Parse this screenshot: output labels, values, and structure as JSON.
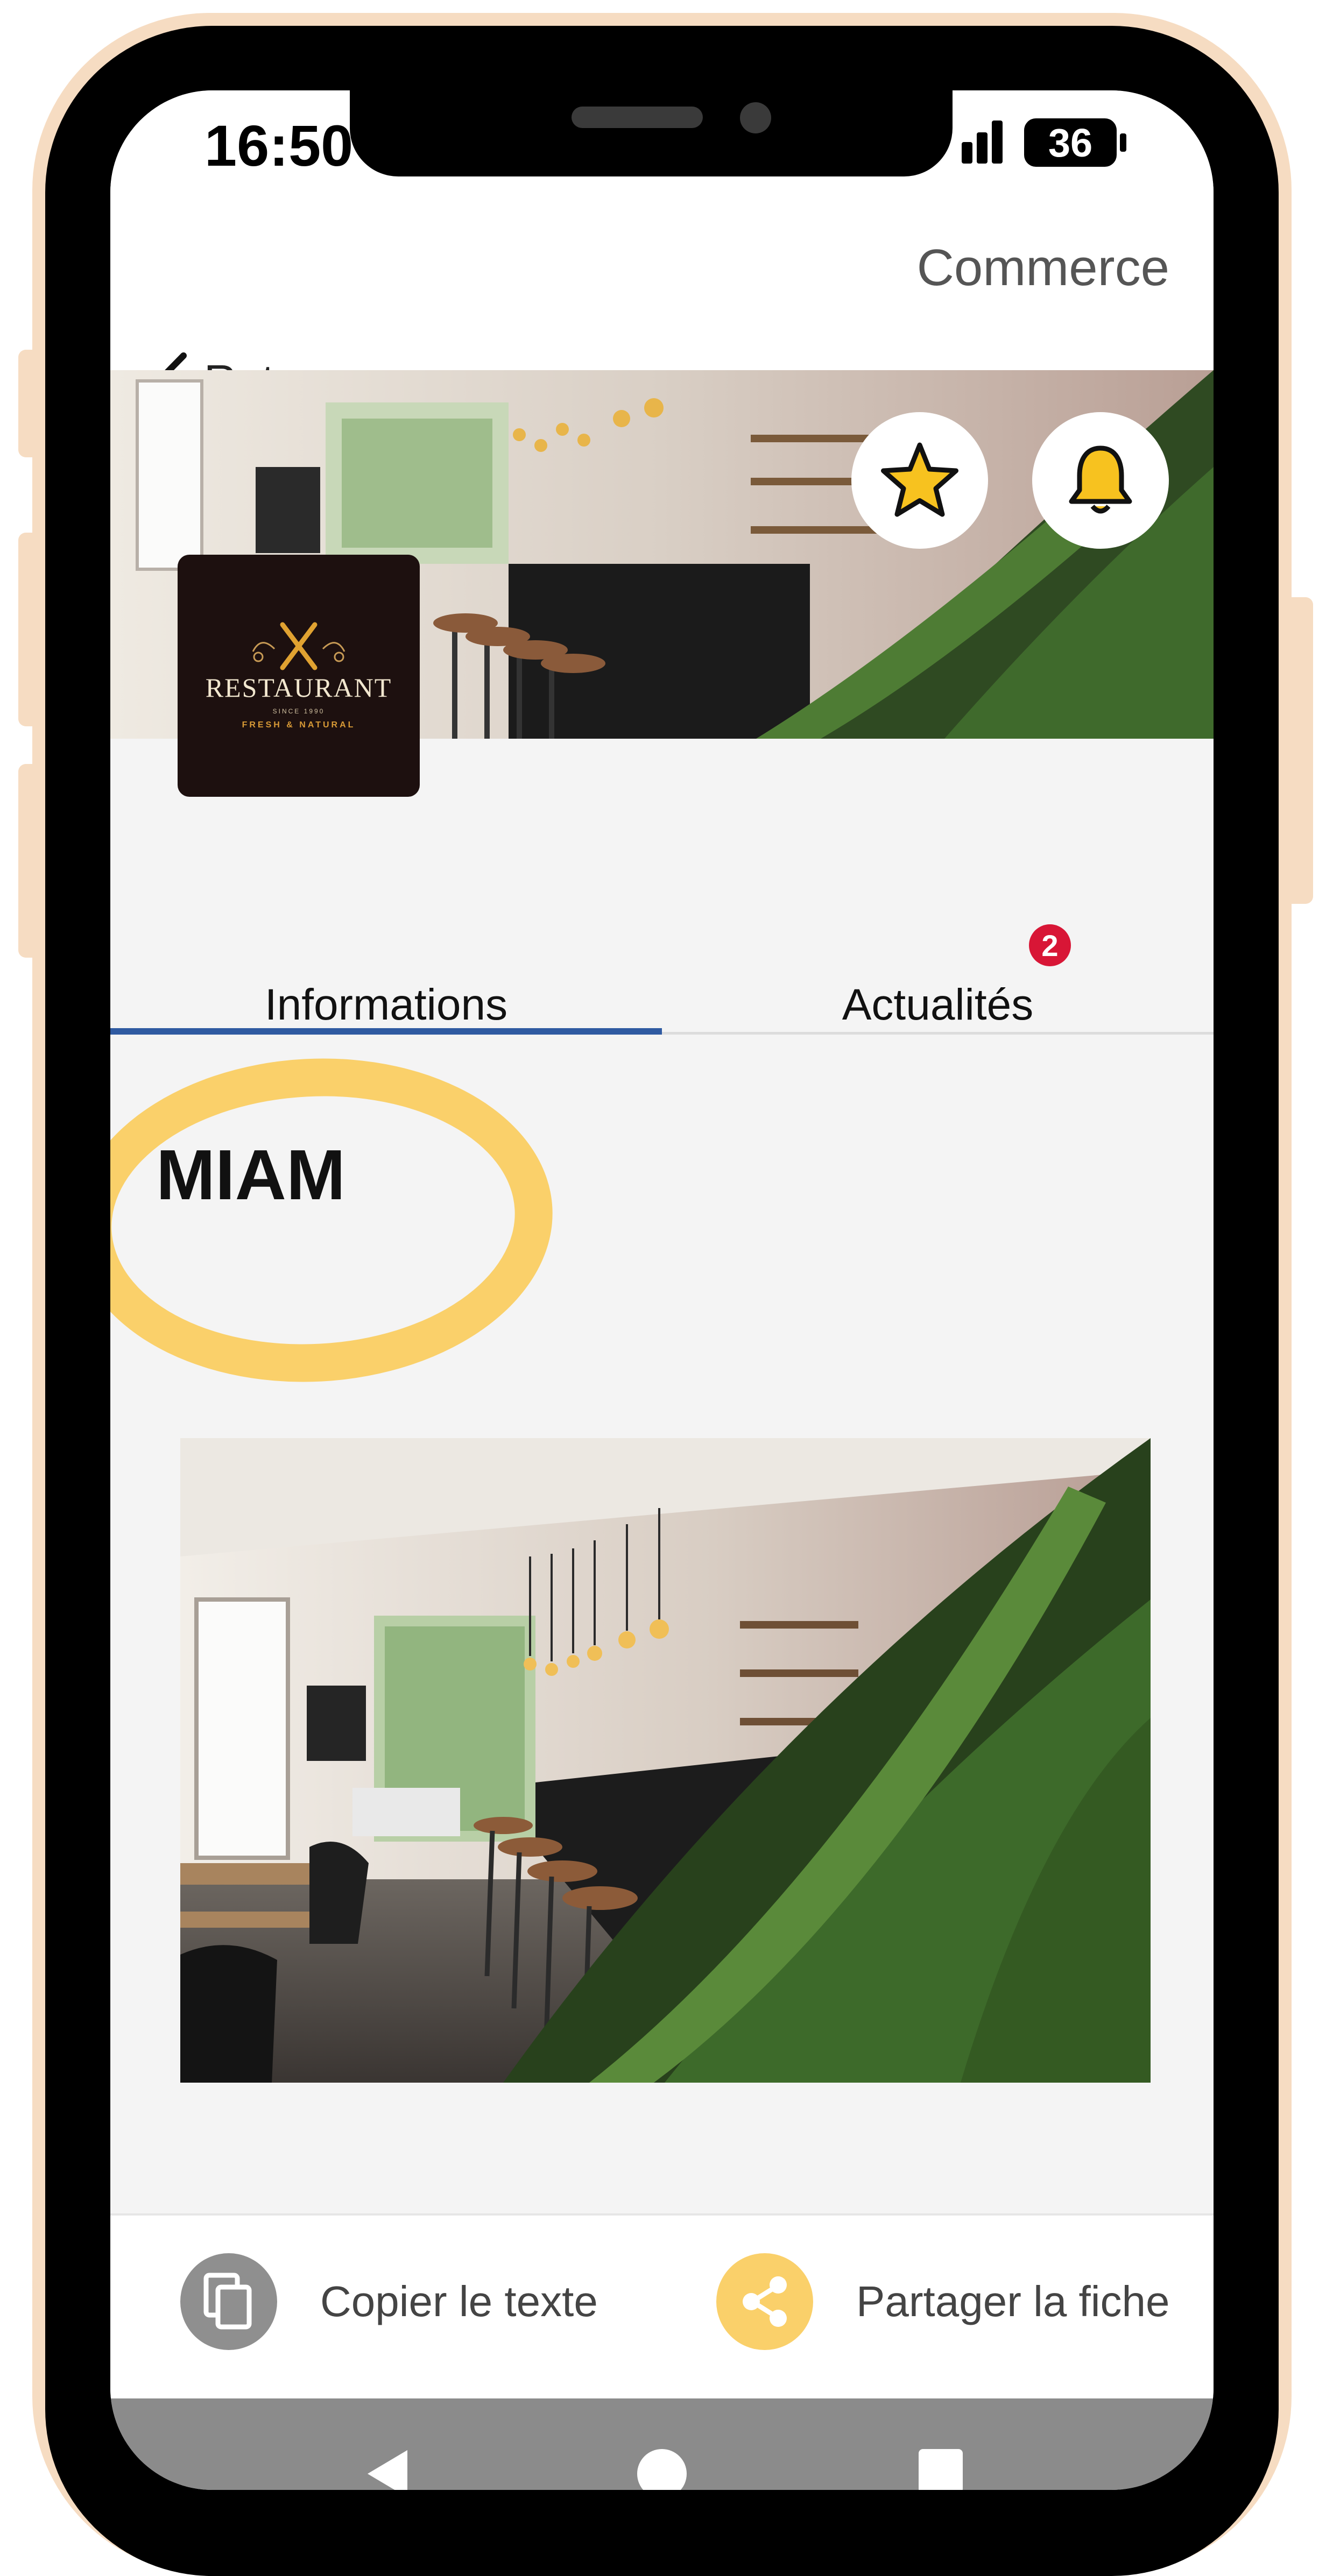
{
  "status_bar": {
    "time": "16:50",
    "battery": "36",
    "icons": [
      "signal-icon",
      "battery-icon"
    ]
  },
  "header": {
    "back_label": "Retour",
    "title": "Commerce",
    "back_icon": "chevron-left-icon"
  },
  "cover": {
    "favorite_icon": "star-icon",
    "notify_icon": "bell-icon"
  },
  "logo": {
    "word": "RESTAURANT",
    "since": "SINCE 1990",
    "tagline": "FRESH & NATURAL"
  },
  "tabs": {
    "items": [
      {
        "label": "Informations",
        "active": true
      },
      {
        "label": "Actualités",
        "active": false
      }
    ],
    "news_badge": "2"
  },
  "business": {
    "name": "MIAM"
  },
  "actions": {
    "copy_label": "Copier le texte",
    "share_label": "Partager la fiche",
    "copy_icon": "copy-icon",
    "share_icon": "share-icon"
  },
  "colors": {
    "accent_yellow": "#fad06a",
    "tab_underline": "#2f5aa1",
    "badge_red": "#d81636",
    "copy_circle": "#8f8f8f"
  }
}
